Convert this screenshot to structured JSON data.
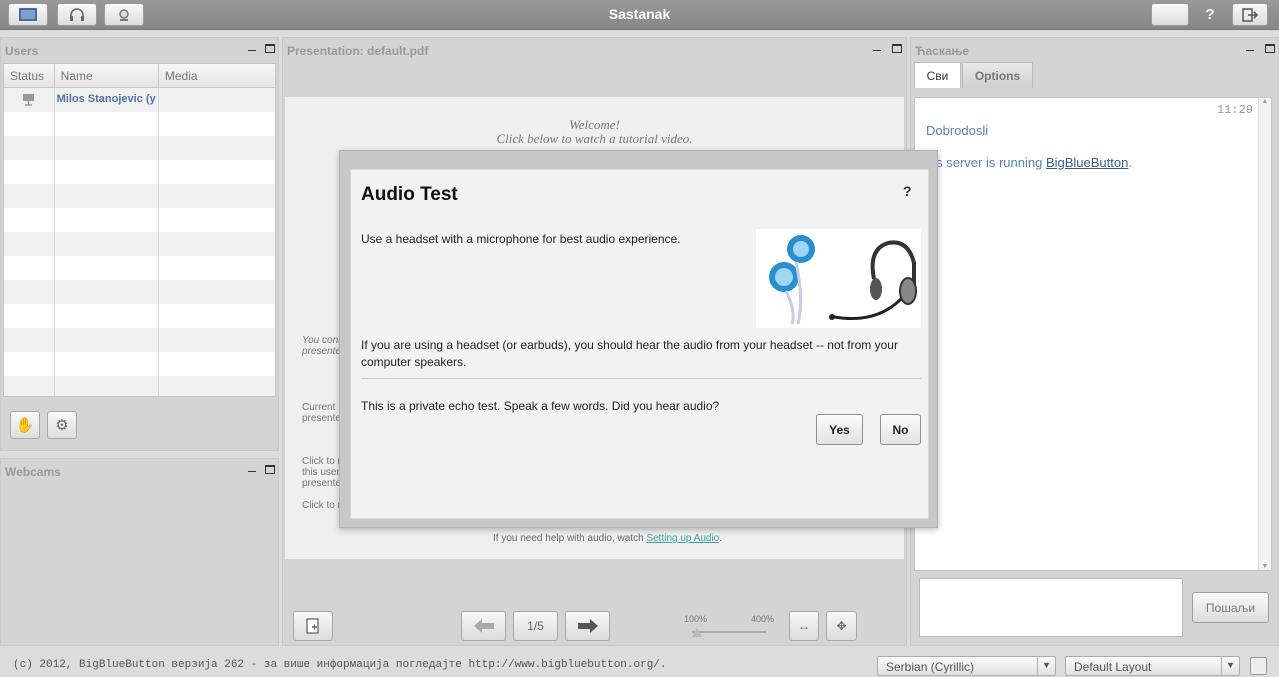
{
  "app": {
    "title": "Sastanak",
    "help_label": "?"
  },
  "users_panel": {
    "title": "Users",
    "columns": [
      "Status",
      "Name",
      "Media"
    ],
    "rows": [
      {
        "name": "Milos Stanojevic (y"
      }
    ]
  },
  "webcams_panel": {
    "title": "Webcams"
  },
  "presentation": {
    "title": "Presentation: default.pdf",
    "welcome_line1": "Welcome!",
    "welcome_line2": "Click below to watch a tutorial video.",
    "side_text1": "You cont",
    "side_text2": "presente",
    "side_text3": "Current",
    "side_text4": "presente",
    "side_text5": "Click to m",
    "side_text6": "this user",
    "side_text7": "presente",
    "side_text8": "Click to m",
    "help_prefix": "If you need help with audio, watch ",
    "help_link": "Setting up Audio",
    "help_suffix": ".",
    "page_indicator": "1/5",
    "zoom_min": "100%",
    "zoom_max": "400%"
  },
  "chat_panel": {
    "title": "Ћаскање",
    "tabs": [
      "Сви",
      "Options"
    ],
    "time": "11:29",
    "message1": "Dobrodosli",
    "message2_prefix": "his server is running ",
    "message2_link": "BigBlueButton",
    "message2_suffix": ".",
    "send_label": "Пошаљи"
  },
  "dialog": {
    "title": "Audio Test",
    "help": "?",
    "line1": "Use a headset with a microphone for best audio experience.",
    "line2": "If you are using a headset (or earbuds), you should hear the audio from your headset -- not from your computer speakers.",
    "line3": "This is a private echo test.  Speak a few words.  Did you hear audio?",
    "yes_label": "Yes",
    "no_label": "No"
  },
  "footer": {
    "copyright": "(c) 2012, BigBlueButton верзија 262 - за више информација погледајте http://www.bigbluebutton.org/.",
    "language": "Serbian (Cyrillic)",
    "layout": "Default Layout"
  },
  "colors": {
    "link": "#3a6aa8",
    "chat_text": "#5b7fc0",
    "topbar": "#8e8e8e"
  }
}
